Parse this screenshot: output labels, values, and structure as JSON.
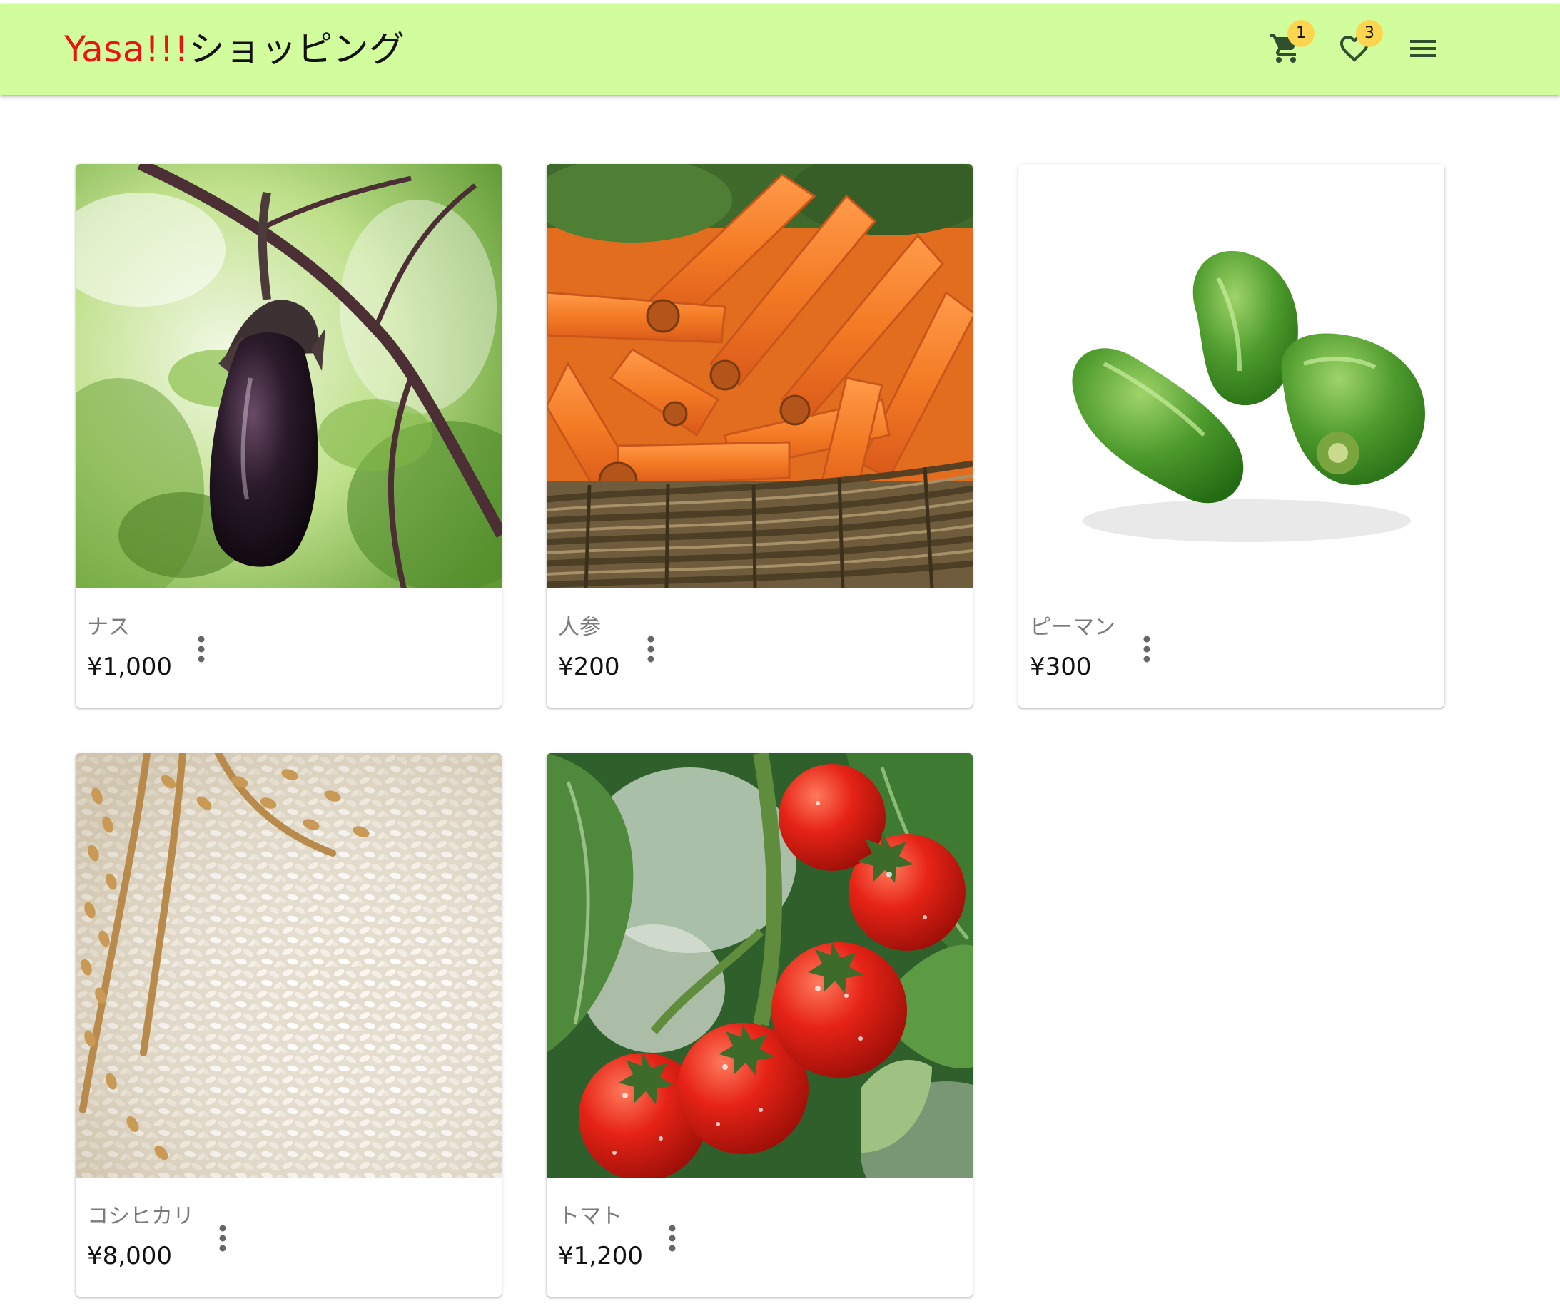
{
  "header": {
    "brand_accent": "Yasa!!!",
    "brand_rest": "ショッピング",
    "background_color": "#d2fd9c",
    "accent_color": "#ee1111",
    "badge_color": "#fdd54f",
    "cart": {
      "icon": "cart-icon",
      "count": "1"
    },
    "favorites": {
      "icon": "heart-icon",
      "count": "3"
    },
    "menu": {
      "icon": "menu-icon"
    }
  },
  "products": [
    {
      "name": "ナス",
      "price": "¥1,000",
      "image": "eggplant"
    },
    {
      "name": "人参",
      "price": "¥200",
      "image": "carrots"
    },
    {
      "name": "ピーマン",
      "price": "¥300",
      "image": "green-peppers"
    },
    {
      "name": "コシヒカリ",
      "price": "¥8,000",
      "image": "rice"
    },
    {
      "name": "トマト",
      "price": "¥1,200",
      "image": "tomatoes"
    }
  ]
}
